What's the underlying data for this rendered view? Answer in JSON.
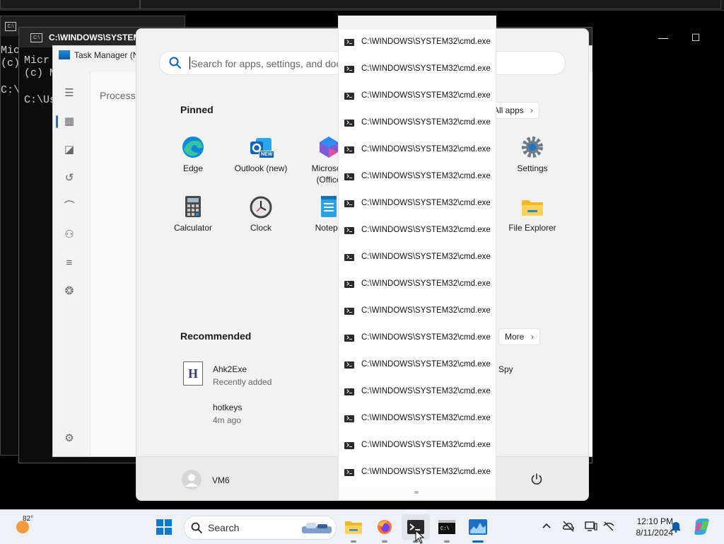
{
  "console": {
    "back_window_lines": [
      "Micr",
      "(c) ",
      "",
      "C:\\U"
    ],
    "window_title": "C:\\WINDOWS\\SYSTEM",
    "front_window_lines": [
      "Micr",
      "(c) M",
      "",
      "C:\\Us"
    ]
  },
  "task_manager": {
    "title": "Task Manager (N",
    "tab_processes": "Processe"
  },
  "start_menu": {
    "search_placeholder": "Search for apps, settings, and doc",
    "pinned_title": "Pinned",
    "all_apps_label": "All apps",
    "pinned_apps": [
      {
        "label": "Edge",
        "icon": "edge-icon"
      },
      {
        "label": "Outlook (new)",
        "icon": "outlook-icon",
        "badge": "NEW"
      },
      {
        "label": "Microsoft",
        "sublabel": "(Office",
        "icon": "microsoft-365-icon"
      },
      {
        "label": "Settings",
        "icon": "gear-icon"
      },
      {
        "label": "Calculator",
        "icon": "calculator-icon"
      },
      {
        "label": "Clock",
        "icon": "clock-icon"
      },
      {
        "label": "Notepa",
        "icon": "notepad-icon"
      },
      {
        "label": "File Explorer",
        "icon": "folder-icon"
      }
    ],
    "recommended_title": "Recommended",
    "more_label": "More",
    "recommended": [
      {
        "name": "Ahk2Exe",
        "sub": "Recently added",
        "icon": "ahk-icon"
      },
      {
        "name": "hotkeys",
        "sub": "4m ago"
      }
    ],
    "recommended_right_partial": "Spy",
    "user_name": "VM6"
  },
  "jump_list": {
    "items": [
      "C:\\WINDOWS\\SYSTEM32\\cmd.exe",
      "C:\\WINDOWS\\SYSTEM32\\cmd.exe",
      "C:\\WINDOWS\\SYSTEM32\\cmd.exe",
      "C:\\WINDOWS\\SYSTEM32\\cmd.exe",
      "C:\\WINDOWS\\SYSTEM32\\cmd.exe",
      "C:\\WINDOWS\\SYSTEM32\\cmd.exe",
      "C:\\WINDOWS\\SYSTEM32\\cmd.exe",
      "C:\\WINDOWS\\SYSTEM32\\cmd.exe",
      "C:\\WINDOWS\\SYSTEM32\\cmd.exe",
      "C:\\WINDOWS\\SYSTEM32\\cmd.exe",
      "C:\\WINDOWS\\SYSTEM32\\cmd.exe",
      "C:\\WINDOWS\\SYSTEM32\\cmd.exe",
      "C:\\WINDOWS\\SYSTEM32\\cmd.exe",
      "C:\\WINDOWS\\SYSTEM32\\cmd.exe",
      "C:\\WINDOWS\\SYSTEM32\\cmd.exe",
      "C:\\WINDOWS\\SYSTEM32\\cmd.exe",
      "C:\\WINDOWS\\SYSTEM32\\cmd.exe"
    ]
  },
  "taskbar": {
    "weather_temp": "82°",
    "search_label": "Search",
    "time": "12:10 PM",
    "date": "8/11/2024"
  },
  "colors": {
    "accent": "#0067c0",
    "start_bg": "#f2f2f2",
    "taskbar_bg": "#eef2f6"
  }
}
